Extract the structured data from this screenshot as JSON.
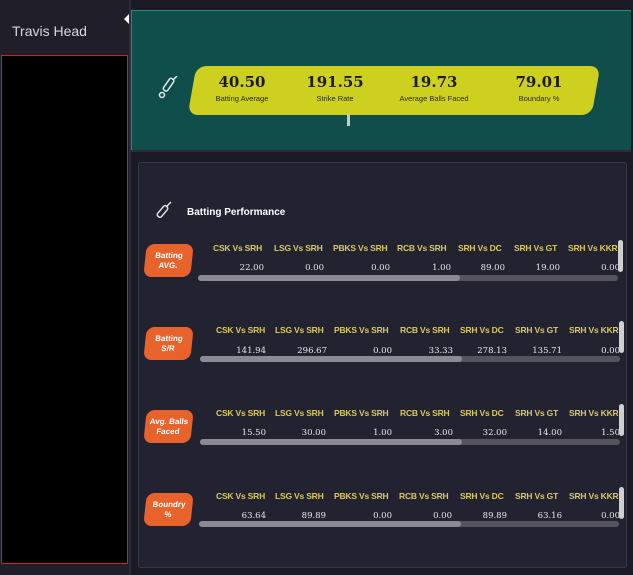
{
  "player": {
    "name": "Travis Head"
  },
  "stats": [
    {
      "value": "40.50",
      "label": "Batting Average"
    },
    {
      "value": "191.55",
      "label": "Strike Rate"
    },
    {
      "value": "19.73",
      "label": "Average Balls Faced"
    },
    {
      "value": "79.01",
      "label": "Boundary %"
    }
  ],
  "performance": {
    "title": "Batting Performance",
    "matches": [
      "CSK Vs SRH",
      "LSG Vs SRH",
      "PBKS Vs SRH",
      "RCB Vs SRH",
      "SRH Vs DC",
      "SRH Vs GT",
      "SRH Vs KKR"
    ],
    "sections": [
      {
        "label": "Batting AVG.",
        "values": [
          "22.00",
          "0.00",
          "0.00",
          "1.00",
          "89.00",
          "19.00",
          "0.00"
        ]
      },
      {
        "label": "Batting S/R",
        "values": [
          "141.94",
          "296.67",
          "0.00",
          "33.33",
          "278.13",
          "135.71",
          "0.00"
        ]
      },
      {
        "label": "Avg. Balls Faced",
        "values": [
          "15.50",
          "30.00",
          "1.00",
          "3.00",
          "32.00",
          "14.00",
          "1.50"
        ]
      },
      {
        "label": "Boundry %",
        "values": [
          "63.64",
          "89.89",
          "0.00",
          "0.00",
          "89.89",
          "63.16",
          "0.00"
        ]
      }
    ]
  },
  "colors": {
    "banner": "#0f4e4b",
    "pill": "#cdd01e",
    "badge": "#e8622c",
    "header_text": "#d9c860"
  }
}
